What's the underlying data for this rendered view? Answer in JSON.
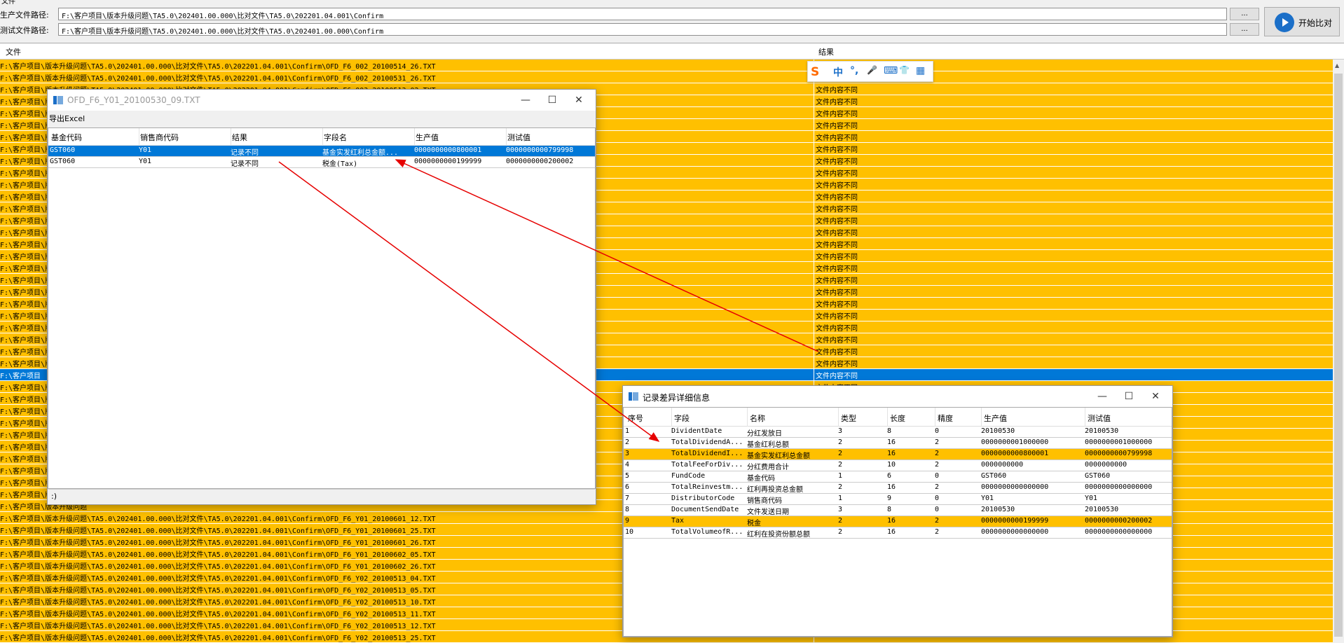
{
  "menu": {
    "label": "文件"
  },
  "paths": {
    "prod_label": "生产文件路径:",
    "prod_value": "F:\\客户项目\\版本升级问题\\TA5.0\\202401.00.000\\比对文件\\TA5.0\\202201.04.001\\Confirm",
    "test_label": "测试文件路径:",
    "test_value": "F:\\客户项目\\版本升级问题\\TA5.0\\202401.00.000\\比对文件\\TA5.0\\202401.00.000\\Confirm",
    "browse_label": "...",
    "start_label": "开始比对"
  },
  "grid": {
    "col_file": "文件",
    "col_result": "结果",
    "rows": [
      {
        "file": "F:\\客户项目\\版本升级问题\\TA5.0\\202401.00.000\\比对文件\\TA5.0\\202201.04.001\\Confirm\\OFD_F6_002_20100514_26.TXT",
        "result": "文件内容不同",
        "sel": false
      },
      {
        "file": "F:\\客户项目\\版本升级问题\\TA5.0\\202401.00.000\\比对文件\\TA5.0\\202201.04.001\\Confirm\\OFD_F6_002_20100531_26.TXT",
        "result": "文件内容不同",
        "sel": false
      },
      {
        "file": "F:\\客户项目\\版本升级问题\\TA5.0\\202401.00.000\\比对文件\\TA5.0\\202201.04.001\\Confirm\\OFD_F6_003_20100513_02.TXT",
        "result": "文件内容不同",
        "sel": false
      },
      {
        "file": "F:\\客户项目\\版本升级问题",
        "result": "文件内容不同",
        "sel": false
      },
      {
        "file": "F:\\客户项目\\版本升级问题",
        "result": "文件内容不同",
        "sel": false
      },
      {
        "file": "F:\\客户项目\\版本升级问题",
        "result": "文件内容不同",
        "sel": false
      },
      {
        "file": "F:\\客户项目\\版本升级问题",
        "result": "文件内容不同",
        "sel": false
      },
      {
        "file": "F:\\客户项目\\版本升级问题",
        "result": "文件内容不同",
        "sel": false
      },
      {
        "file": "F:\\客户项目\\版本升级问题",
        "result": "文件内容不同",
        "sel": false
      },
      {
        "file": "F:\\客户项目\\版本升级问题",
        "result": "文件内容不同",
        "sel": false
      },
      {
        "file": "F:\\客户项目\\版本升级问题",
        "result": "文件内容不同",
        "sel": false
      },
      {
        "file": "F:\\客户项目\\版本升级问题",
        "result": "文件内容不同",
        "sel": false
      },
      {
        "file": "F:\\客户项目\\版本升级问题",
        "result": "文件内容不同",
        "sel": false
      },
      {
        "file": "F:\\客户项目\\版本升级问题",
        "result": "文件内容不同",
        "sel": false
      },
      {
        "file": "F:\\客户项目\\版本升级问题",
        "result": "文件内容不同",
        "sel": false
      },
      {
        "file": "F:\\客户项目\\版本升级问题",
        "result": "文件内容不同",
        "sel": false
      },
      {
        "file": "F:\\客户项目\\版本升级问题",
        "result": "文件内容不同",
        "sel": false
      },
      {
        "file": "F:\\客户项目\\版本升级问题",
        "result": "文件内容不同",
        "sel": false
      },
      {
        "file": "F:\\客户项目\\版本升级问题",
        "result": "文件内容不同",
        "sel": false
      },
      {
        "file": "F:\\客户项目\\版本升级问题",
        "result": "文件内容不同",
        "sel": false
      },
      {
        "file": "F:\\客户项目\\版本升级问题",
        "result": "文件内容不同",
        "sel": false
      },
      {
        "file": "F:\\客户项目\\版本升级问题",
        "result": "文件内容不同",
        "sel": false
      },
      {
        "file": "F:\\客户项目\\版本升级问题",
        "result": "文件内容不同",
        "sel": false
      },
      {
        "file": "F:\\客户项目\\版本升级问题",
        "result": "文件内容不同",
        "sel": false
      },
      {
        "file": "F:\\客户项目\\版本升级问题",
        "result": "文件内容不同",
        "sel": false
      },
      {
        "file": "F:\\客户项目\\版本升级问题",
        "result": "文件内容不同",
        "sel": false
      },
      {
        "file": "F:\\客户项目",
        "result": "文件内容不同",
        "sel": true
      },
      {
        "file": "F:\\客户项目\\版本升级问题",
        "result": "文件内容不同",
        "sel": false
      },
      {
        "file": "F:\\客户项目\\版本升级问题",
        "result": "文件内容不同",
        "sel": false
      },
      {
        "file": "F:\\客户项目\\版本升级问题",
        "result": "",
        "sel": false
      },
      {
        "file": "F:\\客户项目\\版本升级问题",
        "result": "",
        "sel": false
      },
      {
        "file": "F:\\客户项目\\版本升级问题",
        "result": "",
        "sel": false
      },
      {
        "file": "F:\\客户项目\\版本升级问题",
        "result": "",
        "sel": false
      },
      {
        "file": "F:\\客户项目\\版本升级问题",
        "result": "",
        "sel": false
      },
      {
        "file": "F:\\客户项目\\版本升级问题",
        "result": "",
        "sel": false
      },
      {
        "file": "F:\\客户项目\\版本升级问题",
        "result": "",
        "sel": false
      },
      {
        "file": "F:\\客户项目\\版本升级问题",
        "result": "",
        "sel": false
      },
      {
        "file": "F:\\客户项目\\版本升级问题",
        "result": "",
        "sel": false
      },
      {
        "file": "F:\\客户项目\\版本升级问题\\TA5.0\\202401.00.000\\比对文件\\TA5.0\\202201.04.001\\Confirm\\OFD_F6_Y01_20100601_12.TXT",
        "result": "",
        "sel": false
      },
      {
        "file": "F:\\客户项目\\版本升级问题\\TA5.0\\202401.00.000\\比对文件\\TA5.0\\202201.04.001\\Confirm\\OFD_F6_Y01_20100601_25.TXT",
        "result": "",
        "sel": false
      },
      {
        "file": "F:\\客户项目\\版本升级问题\\TA5.0\\202401.00.000\\比对文件\\TA5.0\\202201.04.001\\Confirm\\OFD_F6_Y01_20100601_26.TXT",
        "result": "",
        "sel": false
      },
      {
        "file": "F:\\客户项目\\版本升级问题\\TA5.0\\202401.00.000\\比对文件\\TA5.0\\202201.04.001\\Confirm\\OFD_F6_Y01_20100602_05.TXT",
        "result": "",
        "sel": false
      },
      {
        "file": "F:\\客户项目\\版本升级问题\\TA5.0\\202401.00.000\\比对文件\\TA5.0\\202201.04.001\\Confirm\\OFD_F6_Y01_20100602_26.TXT",
        "result": "",
        "sel": false
      },
      {
        "file": "F:\\客户项目\\版本升级问题\\TA5.0\\202401.00.000\\比对文件\\TA5.0\\202201.04.001\\Confirm\\OFD_F6_Y02_20100513_04.TXT",
        "result": "",
        "sel": false
      },
      {
        "file": "F:\\客户项目\\版本升级问题\\TA5.0\\202401.00.000\\比对文件\\TA5.0\\202201.04.001\\Confirm\\OFD_F6_Y02_20100513_05.TXT",
        "result": "",
        "sel": false
      },
      {
        "file": "F:\\客户项目\\版本升级问题\\TA5.0\\202401.00.000\\比对文件\\TA5.0\\202201.04.001\\Confirm\\OFD_F6_Y02_20100513_10.TXT",
        "result": "",
        "sel": false
      },
      {
        "file": "F:\\客户项目\\版本升级问题\\TA5.0\\202401.00.000\\比对文件\\TA5.0\\202201.04.001\\Confirm\\OFD_F6_Y02_20100513_11.TXT",
        "result": "",
        "sel": false
      },
      {
        "file": "F:\\客户项目\\版本升级问题\\TA5.0\\202401.00.000\\比对文件\\TA5.0\\202201.04.001\\Confirm\\OFD_F6_Y02_20100513_12.TXT",
        "result": "",
        "sel": false
      },
      {
        "file": "F:\\客户项目\\版本升级问题\\TA5.0\\202401.00.000\\比对文件\\TA5.0\\202201.04.001\\Confirm\\OFD_F6_Y02_20100513_25.TXT",
        "result": "",
        "sel": false
      }
    ]
  },
  "ime": {
    "logo": "S",
    "items": [
      "中",
      "°,",
      "🎤",
      "⌨",
      "👕",
      "▦"
    ]
  },
  "dlg1": {
    "title": "OFD_F6_Y01_20100530_09.TXT",
    "export_label": "导出Excel",
    "headers": [
      "基金代码",
      "销售商代码",
      "结果",
      "字段名",
      "生产值",
      "测试值"
    ],
    "rows": [
      [
        "GST060",
        "Y01",
        "记录不同",
        "基金实发红利总金额...",
        "0000000000800001",
        "0000000000799998"
      ],
      [
        "GST060",
        "Y01",
        "记录不同",
        "税金(Tax)",
        "0000000000199999",
        "0000000000200002"
      ]
    ],
    "status": ":)"
  },
  "dlg2": {
    "title": "记录差异详细信息",
    "headers": [
      "序号",
      "字段",
      "名称",
      "类型",
      "长度",
      "精度",
      "生产值",
      "测试值"
    ],
    "rows": [
      [
        "1",
        "DividentDate",
        "分红发放日",
        "3",
        "8",
        "0",
        "20100530",
        "20100530"
      ],
      [
        "2",
        "TotalDividendA...",
        "基金红利总额",
        "2",
        "16",
        "2",
        "0000000001000000",
        "0000000001000000"
      ],
      [
        "3",
        "TotalDividendI...",
        "基金实发红利总金额",
        "2",
        "16",
        "2",
        "0000000000800001",
        "0000000000799998"
      ],
      [
        "4",
        "TotalFeeForDiv...",
        "分红费用合计",
        "2",
        "10",
        "2",
        "0000000000",
        "0000000000"
      ],
      [
        "5",
        "FundCode",
        "基金代码",
        "1",
        "6",
        "0",
        "GST060",
        "GST060"
      ],
      [
        "6",
        "TotalReinvestm...",
        "红利再投资总金额",
        "2",
        "16",
        "2",
        "0000000000000000",
        "0000000000000000"
      ],
      [
        "7",
        "DistributorCode",
        "销售商代码",
        "1",
        "9",
        "0",
        "Y01",
        "Y01"
      ],
      [
        "8",
        "DocumentSendDate",
        "文件发送日期",
        "3",
        "8",
        "0",
        "20100530",
        "20100530"
      ],
      [
        "9",
        "Tax",
        "税金",
        "2",
        "16",
        "2",
        "0000000000199999",
        "0000000000200002"
      ],
      [
        "10",
        "TotalVolumeofR...",
        "红利在投资份额总额",
        "2",
        "16",
        "2",
        "0000000000000000",
        "0000000000000000"
      ]
    ],
    "highlight_rows": [
      3,
      9
    ]
  },
  "colors": {
    "highlight": "#ffc000",
    "selection": "#0078d7",
    "accent": "#1b6fc8",
    "arrow": "#e60000"
  }
}
